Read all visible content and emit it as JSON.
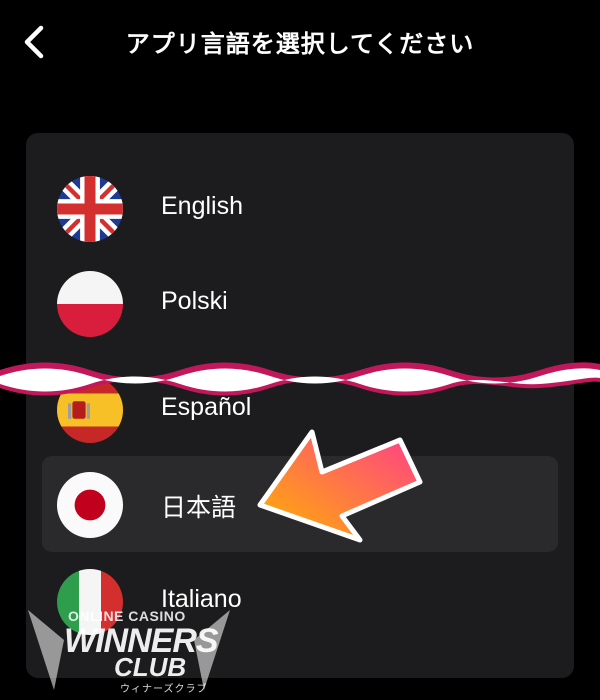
{
  "header": {
    "title": "アプリ言語を選択してください",
    "back_icon": "chevron-left-icon"
  },
  "languages": [
    {
      "label": "English",
      "flag": "uk-flag-icon",
      "selected": false
    },
    {
      "label": "Polski",
      "flag": "poland-flag-icon",
      "selected": false
    },
    {
      "label": "Español",
      "flag": "spain-flag-icon",
      "selected": false
    },
    {
      "label": "日本語",
      "flag": "japan-flag-icon",
      "selected": true
    },
    {
      "label": "Italiano",
      "flag": "italy-flag-icon",
      "selected": false
    }
  ],
  "colors": {
    "background": "#000000",
    "card": "#1c1c1e",
    "selected_row": "#2a2a2c",
    "wave": "#c2185b",
    "arrow_start": "#ffb300",
    "arrow_end": "#ff3d8b"
  },
  "watermark": {
    "line1": "ONLINE CASINO",
    "line2": "WINNERS",
    "line3": "CLUB",
    "line4": "ウィナーズクラブ"
  }
}
